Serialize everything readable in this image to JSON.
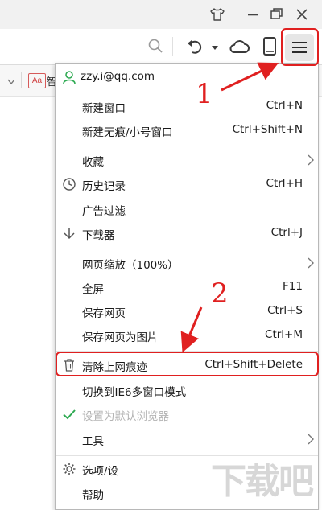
{
  "account": {
    "email": "zzy.i@qq.com"
  },
  "toolbar": {
    "tab_preview_text": "智"
  },
  "menu": {
    "new_window": {
      "label": "新建窗口",
      "shortcut": "Ctrl+N"
    },
    "new_incognito": {
      "label": "新建无痕/小号窗口",
      "shortcut": "Ctrl+Shift+N"
    },
    "favorites": {
      "label": "收藏"
    },
    "history": {
      "label": "历史记录",
      "shortcut": "Ctrl+H"
    },
    "ad_filter": {
      "label": "广告过滤"
    },
    "downloader": {
      "label": "下载器",
      "shortcut": "Ctrl+J"
    },
    "zoom": {
      "label": "网页缩放（100%）"
    },
    "fullscreen": {
      "label": "全屏",
      "shortcut": "F11"
    },
    "save_page": {
      "label": "保存网页",
      "shortcut": "Ctrl+S"
    },
    "save_as_image": {
      "label": "保存网页为图片",
      "shortcut": "Ctrl+M"
    },
    "clear_traces": {
      "label": "清除上网痕迹",
      "shortcut": "Ctrl+Shift+Delete"
    },
    "ie6_mode": {
      "label": "切换到IE6多窗口模式"
    },
    "default_browser": {
      "label": "设置为默认浏览器"
    },
    "tools": {
      "label": "工具"
    },
    "options": {
      "label": "选项/设"
    },
    "help": {
      "label": "帮助"
    }
  },
  "annotations": {
    "step1": "1",
    "step2": "2",
    "color": "#e02020"
  },
  "watermark": {
    "text": "下载吧"
  },
  "icons": [
    "shirt-icon",
    "minimize-icon",
    "maximize-icon",
    "close-icon",
    "search-icon",
    "undo-icon",
    "cloud-icon",
    "phone-icon",
    "menu-hamburger-icon",
    "user-icon",
    "clock-icon",
    "download-arrow-icon",
    "trash-icon",
    "check-icon",
    "gear-icon",
    "chevron-right-icon"
  ]
}
